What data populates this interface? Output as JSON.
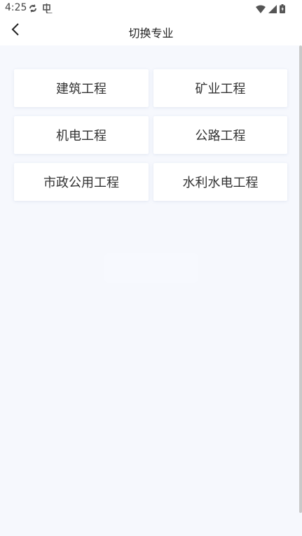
{
  "status_bar": {
    "time": "4:25",
    "left_icons": [
      "sync-icon",
      "app-notification-icon"
    ],
    "right_icons": [
      "wifi-icon",
      "signal-icon",
      "battery-icon"
    ]
  },
  "navbar": {
    "title": "切换专业",
    "back_icon": "chevron-left-icon"
  },
  "majors": [
    {
      "label": "建筑工程"
    },
    {
      "label": "矿业工程"
    },
    {
      "label": "机电工程"
    },
    {
      "label": "公路工程"
    },
    {
      "label": "市政公用工程"
    },
    {
      "label": "水利水电工程"
    }
  ],
  "colors": {
    "background": "#f6f8fd",
    "card": "#ffffff",
    "text": "#333333"
  }
}
